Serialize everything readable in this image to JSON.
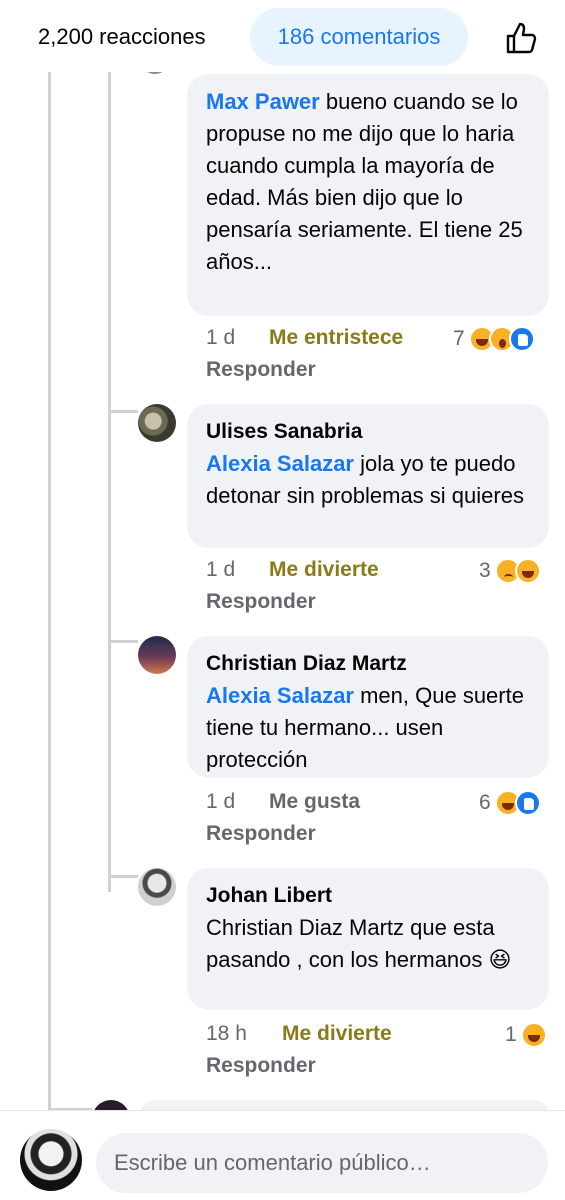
{
  "header": {
    "reactions_label": "2,200 reacciones",
    "comments_label": "186 comentarios",
    "like_icon": "thumbs-up-icon"
  },
  "comments": [
    {
      "mention": "Max Pawer",
      "text": " bueno cuando se lo propuse no me dijo que lo haria cuando cumpla la mayoría de edad. Más bien dijo que lo pensaría seriamente. El tiene 25 años...",
      "time": "1 d",
      "reaction_label": "Me entristece",
      "reaction_count": "7",
      "reply_label": "Responder"
    },
    {
      "author": "Ulises Sanabria",
      "mention": "Alexia Salazar",
      "text": " jola yo te puedo detonar sin problemas si quieres",
      "time": "1 d",
      "reaction_label": "Me divierte",
      "reaction_count": "3",
      "reply_label": "Responder"
    },
    {
      "author": "Christian Diaz Martz",
      "mention": "Alexia Salazar",
      "text": " men, Que suerte tiene tu hermano... usen protección",
      "time": "1 d",
      "reaction_label": "Me gusta",
      "reaction_count": "6",
      "reply_label": "Responder"
    },
    {
      "author": "Johan Libert",
      "text": "Christian Diaz Martz que esta pasando , con los hermanos 😆",
      "time": "18 h",
      "reaction_label": "Me divierte",
      "reaction_count": "1",
      "reply_label": "Responder"
    }
  ],
  "composer": {
    "placeholder": "Escribe un comentario público…"
  },
  "colors": {
    "accent": "#1877f2",
    "bubble": "#f0f2f5",
    "muted": "#65676b",
    "reaction_sad": "#8a7a1a",
    "reaction_haha": "#8a7a1a",
    "reaction_like": "#1877f2"
  }
}
